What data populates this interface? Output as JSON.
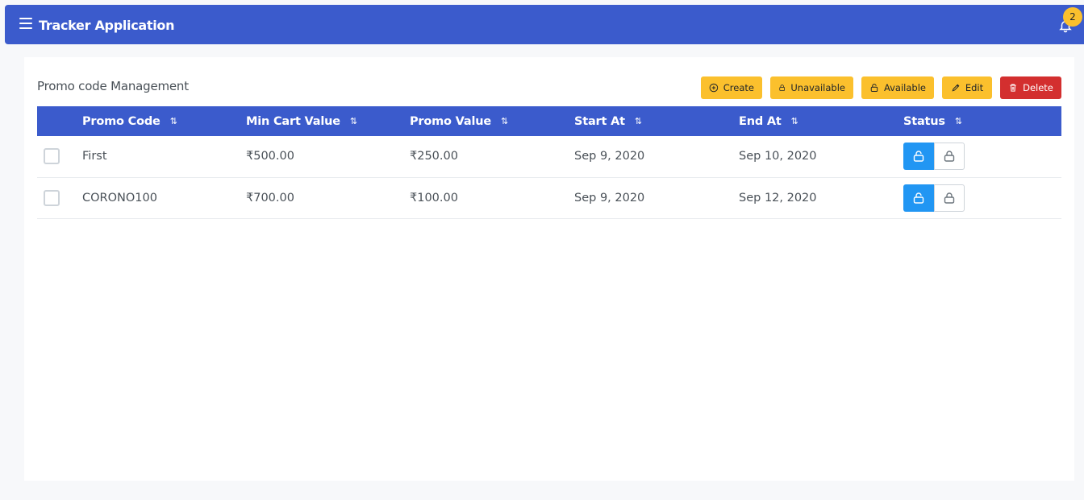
{
  "app": {
    "title": "Tracker Application",
    "notification_count": "2"
  },
  "page": {
    "title": "Promo code Management"
  },
  "toolbar": {
    "create_label": "Create",
    "unavailable_label": "Unavailable",
    "available_label": "Available",
    "edit_label": "Edit",
    "delete_label": "Delete"
  },
  "table": {
    "headers": {
      "code": "Promo Code",
      "min": "Min Cart Value",
      "value": "Promo Value",
      "start": "Start At",
      "end": "End At",
      "status": "Status"
    },
    "rows": [
      {
        "code": "First",
        "min": "₹500.00",
        "value": "₹250.00",
        "start": "Sep 9, 2020",
        "end": "Sep 10, 2020"
      },
      {
        "code": "CORONO100",
        "min": "₹700.00",
        "value": "₹100.00",
        "start": "Sep 9, 2020",
        "end": "Sep 12, 2020"
      }
    ]
  },
  "colors": {
    "primary": "#3b5bcc",
    "warning": "#fbc02d",
    "danger": "#d32f2f",
    "info": "#2196f3"
  },
  "icons": [
    "menu-icon",
    "bell-icon",
    "plus-circle-icon",
    "unlock-icon",
    "lock-icon",
    "pencil-icon",
    "trash-icon",
    "sort-icon"
  ]
}
